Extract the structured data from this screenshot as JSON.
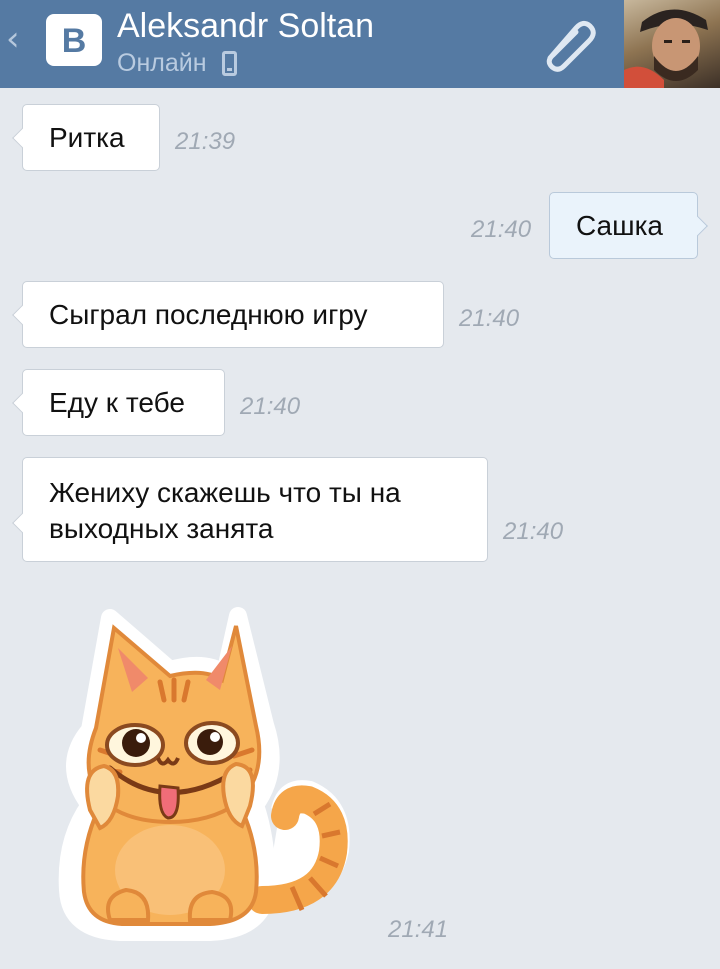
{
  "header": {
    "back_icon": "chevron-left-icon",
    "logo_letter": "В",
    "contact_name": "Aleksandr Soltan",
    "status": "Онлайн",
    "status_icon": "mobile-phone-icon",
    "attach_icon": "paperclip-icon",
    "avatar_icon": "user-avatar"
  },
  "messages": [
    {
      "direction": "in",
      "text": "Ритка",
      "time": "21:39"
    },
    {
      "direction": "out",
      "text": "Сашка",
      "time": "21:40"
    },
    {
      "direction": "in",
      "text": "Сыграл последнюю игру",
      "time": "21:40"
    },
    {
      "direction": "in",
      "text": "Еду к тебе",
      "time": "21:40"
    },
    {
      "direction": "in",
      "text_lines": [
        "Жениху скажешь что ты на",
        "выходных занята"
      ],
      "time": "21:40"
    },
    {
      "direction": "in",
      "type": "sticker",
      "sticker": "orange-cat-sticker",
      "time": "21:41"
    }
  ],
  "colors": {
    "header_bg": "#557aa3",
    "chat_bg": "#e5e9ee",
    "bubble_in": "#ffffff",
    "bubble_out": "#eaf3fb",
    "time_text": "#a0a9b4"
  }
}
